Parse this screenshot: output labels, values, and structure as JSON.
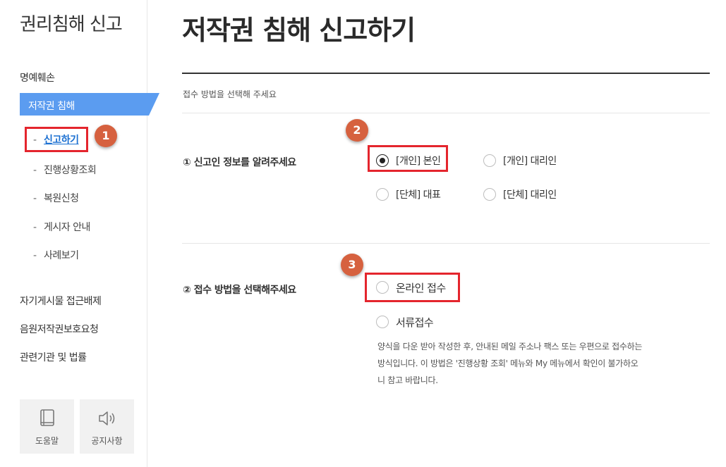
{
  "sidebar": {
    "title": "권리침해 신고",
    "menu": [
      {
        "label": "명예훼손"
      },
      {
        "label": "저작권 침해"
      }
    ],
    "submenu": [
      {
        "label": "신고하기"
      },
      {
        "label": "진행상황조회"
      },
      {
        "label": "복원신청"
      },
      {
        "label": "게시자 안내"
      },
      {
        "label": "사례보기"
      }
    ],
    "bottom_menu": [
      {
        "label": "자기게시물 접근배제"
      },
      {
        "label": "음원저작권보호요청"
      },
      {
        "label": "관련기관 및 법률"
      }
    ],
    "buttons": {
      "help": "도움말",
      "notice": "공지사항"
    },
    "sub_dash": "-"
  },
  "main": {
    "title": "저작권 침해 신고하기",
    "intro": "접수 방법을 선택해 주세요",
    "q1": {
      "label": "① 신고인 정보를 알려주세요",
      "options": [
        {
          "label": "[개인] 본인",
          "checked": true
        },
        {
          "label": "[개인] 대리인",
          "checked": false
        },
        {
          "label": "[단체] 대표",
          "checked": false
        },
        {
          "label": "[단체] 대리인",
          "checked": false
        }
      ]
    },
    "q2": {
      "label": "② 접수 방법을 선택해주세요",
      "options": [
        {
          "label": "온라인 접수",
          "checked": false
        },
        {
          "label": "서류접수",
          "checked": false
        }
      ],
      "note": "양식을 다운 받아 작성한 후, 안내된 메일 주소나 팩스 또는 우편으로 접수하는 방식입니다. 이 방법은 '진행상황 조회' 메뉴와 My 메뉴에서 확인이 불가하오니 참고 바랍니다."
    }
  },
  "annotations": {
    "step1": "1",
    "step2": "2",
    "step3": "3"
  },
  "colors": {
    "active_menu": "#5b9cf0",
    "highlight": "#e4252d",
    "badge": "#d6613f",
    "link": "#1a6fd1"
  }
}
